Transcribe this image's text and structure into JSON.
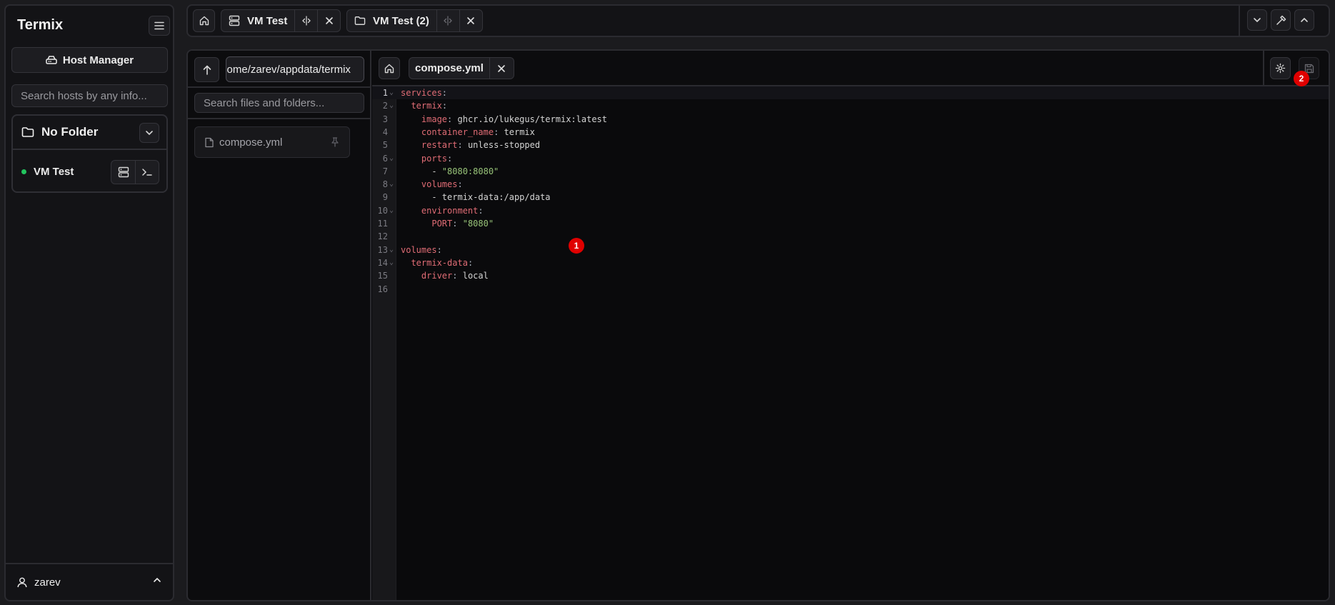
{
  "sidebar": {
    "brand": "Termix",
    "host_manager_label": "Host Manager",
    "search_placeholder": "Search hosts by any info...",
    "folder": {
      "name": "No Folder"
    },
    "hosts": [
      {
        "name": "VM Test",
        "status": "online"
      }
    ],
    "user": {
      "name": "zarev"
    }
  },
  "topbar": {
    "tabs": [
      {
        "label": "VM Test",
        "icon": "server-icon"
      },
      {
        "label": "VM Test (2)",
        "icon": "folder-icon"
      }
    ]
  },
  "file_manager": {
    "path_value": "/home/zarev/appdata/termix",
    "search_placeholder": "Search files and folders...",
    "files": [
      {
        "name": "compose.yml"
      }
    ]
  },
  "editor": {
    "tab_label": "compose.yml",
    "lines": [
      {
        "n": "1",
        "html": "<span class=\"k\">services</span><span class=\"p\">:</span>",
        "fold": true
      },
      {
        "n": "2",
        "html": "  <span class=\"k\">termix</span><span class=\"p\">:</span>",
        "fold": true
      },
      {
        "n": "3",
        "html": "    <span class=\"k\">image</span><span class=\"p\">:</span> ghcr.io/lukegus/termix:latest"
      },
      {
        "n": "4",
        "html": "    <span class=\"k\">container_name</span><span class=\"p\">:</span> termix"
      },
      {
        "n": "5",
        "html": "    <span class=\"k\">restart</span><span class=\"p\">:</span> unless-stopped"
      },
      {
        "n": "6",
        "html": "    <span class=\"k\">ports</span><span class=\"p\">:</span>",
        "fold": true
      },
      {
        "n": "7",
        "html": "      - <span class=\"s\">\"8080:8080\"</span>"
      },
      {
        "n": "8",
        "html": "    <span class=\"k\">volumes</span><span class=\"p\">:</span>",
        "fold": true
      },
      {
        "n": "9",
        "html": "      - termix-data:/app/data"
      },
      {
        "n": "10",
        "html": "    <span class=\"k\">environment</span><span class=\"p\">:</span>",
        "fold": true
      },
      {
        "n": "11",
        "html": "      <span class=\"k\">PORT</span><span class=\"p\">:</span> <span class=\"s\">\"8080\"</span>"
      },
      {
        "n": "12",
        "html": ""
      },
      {
        "n": "13",
        "html": "<span class=\"k\">volumes</span><span class=\"p\">:</span>",
        "fold": true
      },
      {
        "n": "14",
        "html": "  <span class=\"k\">termix-data</span><span class=\"p\">:</span>",
        "fold": true
      },
      {
        "n": "15",
        "html": "    <span class=\"k\">driver</span><span class=\"p\">:</span> local"
      },
      {
        "n": "16",
        "html": ""
      }
    ]
  },
  "badges": [
    "1",
    "2"
  ],
  "colors": {
    "accent_red": "#e00000",
    "status_online": "#22c55e",
    "yaml_key": "#e06c75",
    "yaml_string": "#98c379"
  }
}
